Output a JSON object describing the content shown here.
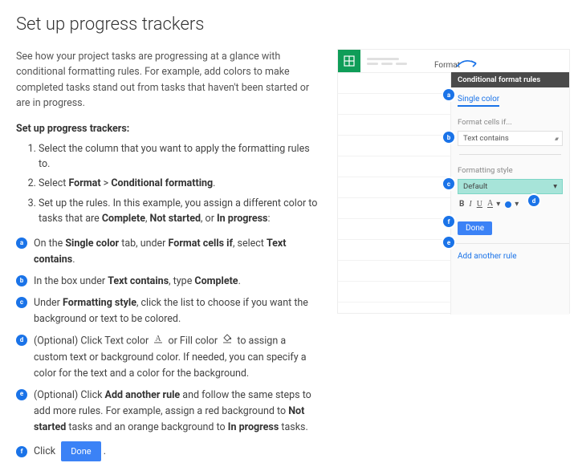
{
  "title": "Set up progress trackers",
  "intro": "See how your project tasks are progressing at a glance with conditional formatting rules. For example, add colors to make completed tasks stand out from tasks that haven't been started or are in progress.",
  "subhead": "Set up progress trackers:",
  "steps": {
    "s1": "Select the column that you want to apply the formatting rules to.",
    "s2a": "Select ",
    "s2b": "Format",
    "s2c": " > ",
    "s2d": "Conditional formatting",
    "s2e": ".",
    "s3a": "Set up the rules. In this example, you assign a different color to tasks that are ",
    "s3b": "Complete",
    "s3c": ", ",
    "s3d": "Not started",
    "s3e": ", or ",
    "s3f": "In progress",
    "s3g": ":"
  },
  "letters": {
    "a": {
      "label": "a",
      "t1": "On the ",
      "b1": "Single color",
      "t2": " tab, under ",
      "b2": "Format cells if",
      "t3": ", select ",
      "b3": "Text contains",
      "t4": "."
    },
    "b": {
      "label": "b",
      "t1": "In the box under ",
      "b1": "Text contains",
      "t2": ", type ",
      "b2": "Complete",
      "t3": "."
    },
    "c": {
      "label": "c",
      "t1": "Under ",
      "b1": "Formatting style",
      "t2": ", click the list to choose if you want the background or text to be colored."
    },
    "d": {
      "label": "d",
      "t1": "(Optional) Click Text color ",
      "t2": " or Fill color ",
      "t3": " to assign a custom text or background color. If needed, you can specify a color for the text and a color for the background."
    },
    "e": {
      "label": "e",
      "t1": "(Optional) Click ",
      "b1": "Add another rule",
      "t2": " and follow the same steps to add more rules. For example, assign a red background to ",
      "b2": "Not started",
      "t3": " tasks and an orange background to ",
      "b3": "In progress",
      "t4": " tasks."
    },
    "f": {
      "label": "f",
      "t1": "Click ",
      "done": "Done",
      "t2": "."
    }
  },
  "mock": {
    "format_menu": "Format",
    "panel_title": "Conditional format rules",
    "tab_single": "Single color",
    "format_cells_if": "Format cells if...",
    "text_contains": "Text contains",
    "formatting_style": "Formatting style",
    "default": "Default",
    "done": "Done",
    "add_another": "Add another rule",
    "callouts": {
      "a": "a",
      "b": "b",
      "c": "c",
      "d": "d",
      "e": "e",
      "f": "f"
    }
  }
}
